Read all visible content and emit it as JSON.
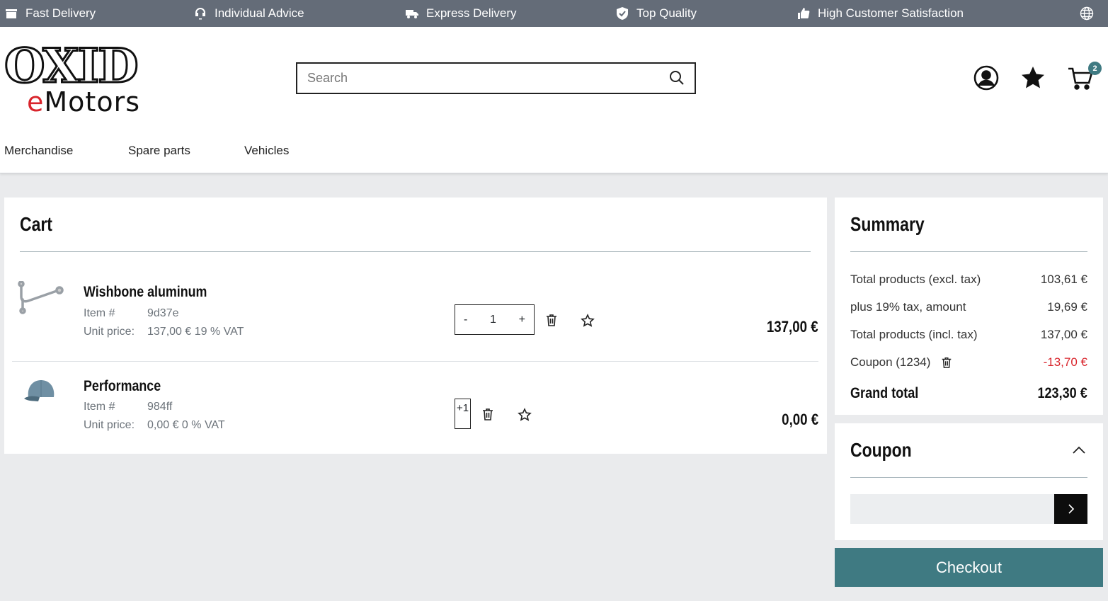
{
  "topbar": {
    "items": [
      "Fast Delivery",
      "Individual Advice",
      "Express Delivery",
      "Top Quality",
      "High Customer Satisfaction"
    ]
  },
  "header": {
    "logo_line1": "OXID",
    "logo_line2_accent": "e",
    "logo_line2_rest": "Motors",
    "search_placeholder": "Search",
    "cart_count": "2"
  },
  "nav": {
    "items": [
      "Merchandise",
      "Spare parts",
      "Vehicles"
    ]
  },
  "cart": {
    "title": "Cart",
    "item_no_label": "Item #",
    "unit_price_label": "Unit price:",
    "items": [
      {
        "name": "Wishbone aluminum",
        "item_no": "9d37e",
        "unit_price": "137,00 € 19 % VAT",
        "qty": "1",
        "minus": "-",
        "plus": "+",
        "total": "137,00 €"
      },
      {
        "name": "Performance",
        "item_no": "984ff",
        "unit_price": "0,00 € 0 % VAT",
        "qty": "+1",
        "total": "0,00 €"
      }
    ]
  },
  "summary": {
    "title": "Summary",
    "rows": [
      {
        "label": "Total products (excl. tax)",
        "value": "103,61 €"
      },
      {
        "label": "plus 19% tax, amount",
        "value": "19,69 €"
      },
      {
        "label": "Total products (incl. tax)",
        "value": "137,00 €"
      },
      {
        "label": "Coupon (1234)",
        "value": "-13,70 €"
      }
    ],
    "grand_label": "Grand total",
    "grand_value": "123,30 €"
  },
  "coupon": {
    "title": "Coupon",
    "input_value": ""
  },
  "checkout": {
    "label": "Checkout"
  },
  "colors": {
    "topbar": "#646c78",
    "accent": "#3f7a82",
    "negative": "#d9252c"
  }
}
